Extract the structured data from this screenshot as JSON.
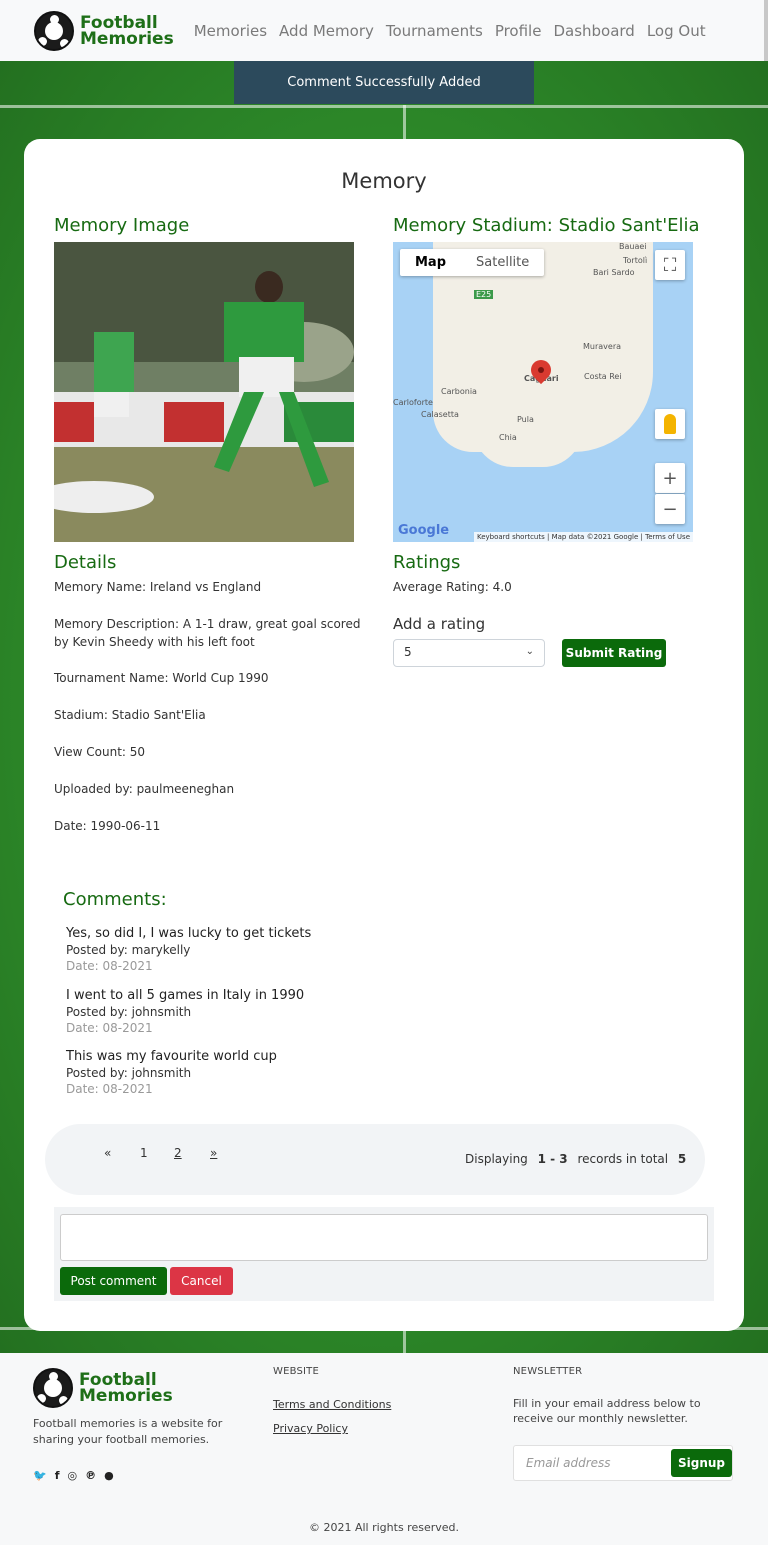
{
  "nav": {
    "brand_line1": "Football",
    "brand_line2": "Memories",
    "links": [
      "Memories",
      "Add Memory",
      "Tournaments",
      "Profile",
      "Dashboard",
      "Log Out"
    ]
  },
  "alert": "Comment Successfully Added",
  "page": {
    "title": "Memory",
    "image_heading": "Memory Image",
    "stadium_heading": "Memory Stadium: Stadio Sant'Elia"
  },
  "map": {
    "map_tab": "Map",
    "satellite_tab": "Satellite",
    "places": [
      "Bauaei",
      "Tortolì",
      "Bari Sardo",
      "Muravera",
      "Costa Rei",
      "Carbonia",
      "Calasetta",
      "Carloforte",
      "Pula",
      "Chia",
      "Cagliari",
      "E25"
    ],
    "keyboard": "Keyboard shortcuts",
    "attribution": "Map data ©2021 Google",
    "terms": "Terms of Use",
    "logo": "Google"
  },
  "details": {
    "heading": "Details",
    "name": "Memory Name: Ireland vs England",
    "description": "Memory Description: A 1-1 draw, great goal scored by Kevin Sheedy with his left foot",
    "tournament": "Tournament Name: World Cup 1990",
    "stadium": "Stadium: Stadio Sant'Elia",
    "views": "View Count: 50",
    "uploader": "Uploaded by: paulmeeneghan",
    "date": "Date: 1990-06-11"
  },
  "ratings": {
    "heading": "Ratings",
    "average": "Average Rating: 4.0",
    "add_label": "Add a rating",
    "selected": "5",
    "submit": "Submit Rating"
  },
  "comments": {
    "heading": "Comments:",
    "items": [
      {
        "text": "Yes, so did I, I was lucky to get tickets",
        "by": "Posted by: marykelly",
        "date": "Date: 08-2021"
      },
      {
        "text": "I went to all 5 games in Italy in 1990",
        "by": "Posted by: johnsmith",
        "date": "Date: 08-2021"
      },
      {
        "text": "This was my favourite world cup",
        "by": "Posted by: johnsmith",
        "date": "Date: 08-2021"
      }
    ]
  },
  "pagination": {
    "prev": "«",
    "page1": "1",
    "page2": "2",
    "next": "»",
    "display_prefix": "Displaying",
    "range": "1 - 3",
    "middle": "records in total",
    "total": "5"
  },
  "comment_form": {
    "post": "Post comment",
    "cancel": "Cancel"
  },
  "footer": {
    "brand_line1": "Football",
    "brand_line2": "Memories",
    "description": "Football memories is a website for sharing your football memories.",
    "website_heading": "WEBSITE",
    "terms": "Terms and Conditions",
    "privacy": "Privacy Policy",
    "newsletter_heading": "NEWSLETTER",
    "newsletter_text": "Fill in your email address below to receive our monthly newsletter.",
    "email_placeholder": "Email address",
    "signup": "Signup",
    "copyright": "© 2021 All rights reserved.",
    "social": [
      "twitter-icon",
      "facebook-icon",
      "instagram-icon",
      "pinterest-icon",
      "snapchat-icon"
    ]
  }
}
